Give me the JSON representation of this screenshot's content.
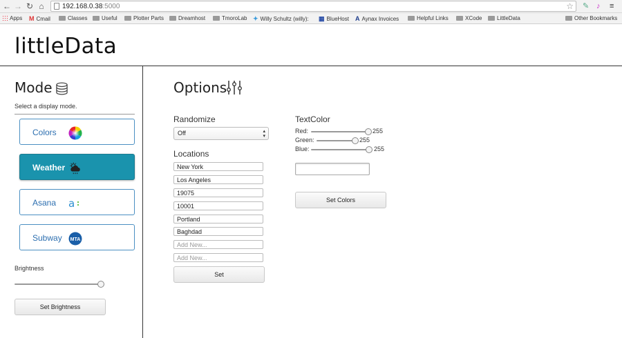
{
  "browser": {
    "url_host": "192.168.0.38",
    "url_port": ":5000",
    "bookmarks": [
      "Apps",
      "Cmail",
      "Classes",
      "Useful",
      "Plotter Parts",
      "Dreamhost",
      "TmoroLab",
      "Willy Schultz (willy):",
      "BlueHost",
      "Aynax Invoices",
      "Helpful Links",
      "XCode",
      "LittleData",
      "Other Bookmarks"
    ]
  },
  "app": {
    "title": "littleData"
  },
  "mode": {
    "title": "Mode",
    "subtitle": "Select a display mode.",
    "buttons": [
      {
        "label": "Colors",
        "icon": "color-wheel-icon",
        "active": false
      },
      {
        "label": "Weather",
        "icon": "weather-cloud-icon",
        "active": true
      },
      {
        "label": "Asana",
        "icon": "asana-icon",
        "active": false
      },
      {
        "label": "Subway",
        "icon": "mta-icon",
        "active": false
      }
    ],
    "brightness_label": "Brightness",
    "brightness_value": 1.0,
    "set_brightness_label": "Set Brightness"
  },
  "options": {
    "title": "Options",
    "randomize_label": "Randomize",
    "randomize_value": "Off",
    "locations_label": "Locations",
    "locations": [
      "New York",
      "Los Angeles",
      "19075",
      "10001",
      "Portland",
      "Baghdad"
    ],
    "new_placeholder": "Add New...",
    "set_label": "Set"
  },
  "textcolor": {
    "title": "TextColor",
    "red_label": "Red:",
    "green_label": "Green:",
    "blue_label": "Blue:",
    "red": "255",
    "green": "255",
    "blue": "255",
    "set_colors_label": "Set Colors"
  },
  "colors": {
    "accent": "#1a93ad",
    "mode_border": "#4a8fc2",
    "mode_text": "#2d6fb0"
  }
}
